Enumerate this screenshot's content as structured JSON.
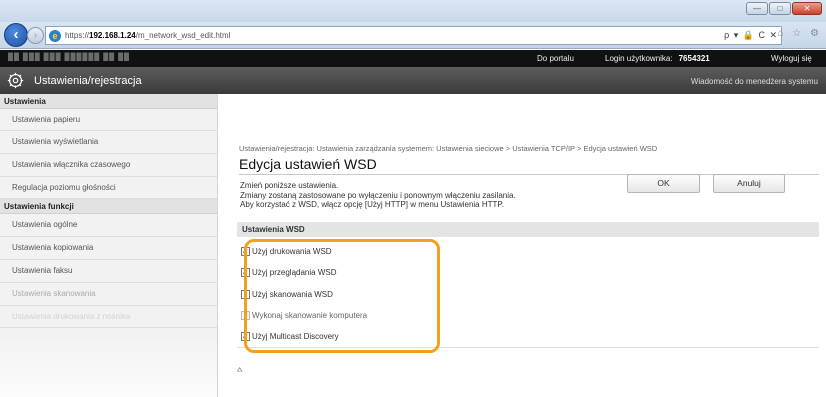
{
  "browser": {
    "url_prefix": "https://",
    "url_host": "192.168.1.24",
    "url_path": "/m_network_wsd_edit.html",
    "url_tools": "ρ ▾ 🔒 C ✕",
    "tab_tools": "⌂ ☆ ⚙",
    "window_buttons": {
      "minimize": "—",
      "maximize": "□",
      "close": "✕"
    }
  },
  "header": {
    "blurred_title": "██ ███ ███ ██████ ██ ██",
    "portal_link": "Do portalu",
    "login_label": "Login użytkownika:",
    "login_value": "7654321",
    "logout": "Wyloguj się",
    "app_title": "Ustawienia/rejestracja",
    "admin_message": "Wiadomość do menedżera systemu"
  },
  "sidebar": {
    "section1": "Ustawienia",
    "items1": [
      "Ustawienia papieru",
      "Ustawienia wyświetlania",
      "Ustawienia włącznika czasowego",
      "Regulacja poziomu głośności"
    ],
    "section2": "Ustawienia funkcji",
    "items2": [
      "Ustawienia ogólne",
      "Ustawienia kopiowania",
      "Ustawienia faksu",
      "Ustawienia skanowania",
      "Ustawienia drukowania z nośnika"
    ]
  },
  "main": {
    "breadcrumb": "Ustawienia/rejestracja: Ustawienia zarządzania systemem: Ustawienia sieciowe > Ustawienia TCP/IP > Edycja ustawień WSD",
    "title": "Edycja ustawień WSD",
    "desc_line1": "Zmień poniższe ustawienia.",
    "desc_line2": "Zmiany zostaną zastosowane po wyłączeniu i ponownym włączeniu zasilania.",
    "desc_line3": "Aby korzystać z WSD, włącz opcję [Użyj HTTP] w menu Ustawienia HTTP.",
    "ok_label": "OK",
    "cancel_label": "Anuluj",
    "section_title": "Ustawienia WSD",
    "options": [
      {
        "label": "Użyj drukowania WSD",
        "checked": true,
        "disabled": false
      },
      {
        "label": "Użyj przeglądania WSD",
        "checked": true,
        "disabled": false
      },
      {
        "label": "Użyj skanowania WSD",
        "checked": false,
        "disabled": false
      },
      {
        "label": "Wykonaj skanowanie komputera",
        "checked": false,
        "disabled": true
      },
      {
        "label": "Użyj Multicast Discovery",
        "checked": true,
        "disabled": false
      }
    ],
    "top_link": "⩟",
    "highlight_color": "#f2a11e"
  }
}
